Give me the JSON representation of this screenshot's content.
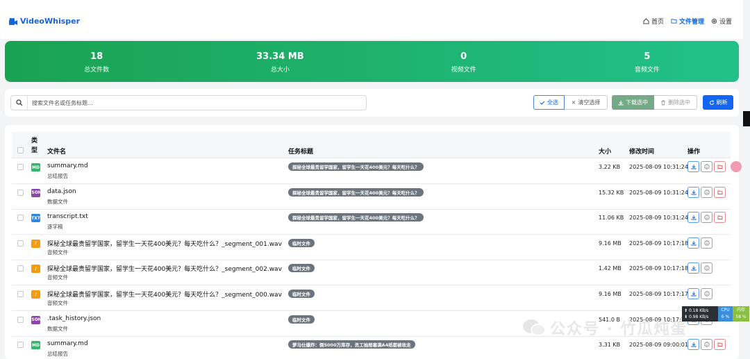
{
  "app": {
    "brand": "VideoWhisper"
  },
  "nav": {
    "home": "首页",
    "files": "文件管理",
    "settings": "设置"
  },
  "stats": [
    {
      "value": "18",
      "label": "总文件数"
    },
    {
      "value": "33.34 MB",
      "label": "总大小"
    },
    {
      "value": "0",
      "label": "视频文件"
    },
    {
      "value": "5",
      "label": "音频文件"
    }
  ],
  "toolbar": {
    "search_placeholder": "搜索文件名或任务标题...",
    "select_all": "全选",
    "clear_selection": "清空选择",
    "download_selected": "下载选中",
    "delete_selected": "删除选中",
    "refresh": "刷新"
  },
  "table": {
    "headers": {
      "type": "类型",
      "name": "文件名",
      "task": "任务标题",
      "size": "大小",
      "mtime": "修改时间",
      "actions": "操作"
    },
    "rows": [
      {
        "icon": "MD",
        "icon_color": "#2fb86a",
        "name": "summary.md",
        "type": "总结报告",
        "task": "探秘全球最贵留学国家，留学生一天花400美元？每天吃什么？",
        "size": "3.22 KB",
        "mtime": "2025-08-09 10:31:24",
        "folder": true
      },
      {
        "icon": "JSON",
        "icon_color": "#8e44ad",
        "name": "data.json",
        "type": "数据文件",
        "task": "探秘全球最贵留学国家，留学生一天花400美元？每天吃什么？",
        "size": "15.32 KB",
        "mtime": "2025-08-09 10:31:24",
        "folder": true
      },
      {
        "icon": "TXT",
        "icon_color": "#2e86de",
        "name": "transcript.txt",
        "type": "逐字稿",
        "task": "探秘全球最贵留学国家，留学生一天花400美元？每天吃什么？",
        "size": "11.06 KB",
        "mtime": "2025-08-09 10:31:24",
        "folder": true
      },
      {
        "icon": "♪",
        "icon_color": "#f39c12",
        "name": "探秘全球最贵留学国家，留学生一天花400美元？每天吃什么？_segment_001.wav",
        "type": "音频文件",
        "task": "临时文件",
        "size": "9.16 MB",
        "mtime": "2025-08-09 10:17:18",
        "folder": false
      },
      {
        "icon": "♪",
        "icon_color": "#f39c12",
        "name": "探秘全球最贵留学国家，留学生一天花400美元？每天吃什么？_segment_002.wav",
        "type": "音频文件",
        "task": "临时文件",
        "size": "1.42 MB",
        "mtime": "2025-08-09 10:17:18",
        "folder": false
      },
      {
        "icon": "♪",
        "icon_color": "#f39c12",
        "name": "探秘全球最贵留学国家，留学生一天花400美元？每天吃什么？_segment_000.wav",
        "type": "音频文件",
        "task": "临时文件",
        "size": "9.16 MB",
        "mtime": "2025-08-09 10:17:17",
        "folder": false
      },
      {
        "icon": "JSON",
        "icon_color": "#8e44ad",
        "name": ".task_history.json",
        "type": "数据文件",
        "task": "临时文件",
        "size": "541.0 B",
        "mtime": "2025-08-09 10:17:17",
        "folder": false
      },
      {
        "icon": "MD",
        "icon_color": "#2fb86a",
        "name": "summary.md",
        "type": "总结报告",
        "task": "萝马仕爆炸：倒5000万库存，员工抽屉塞满A4纸都被收走",
        "size": "3.31 KB",
        "mtime": "2025-08-09 09:00:01",
        "folder": true
      }
    ]
  },
  "sysmon": {
    "up": "0.18 KB/s",
    "down": "0.98 KB/s",
    "cpu_label": "CPU",
    "cpu_val": "6 %",
    "mem_label": "内存",
    "mem_val": "58 %"
  },
  "watermark": "公众号 · 竹瓜炖蛋"
}
